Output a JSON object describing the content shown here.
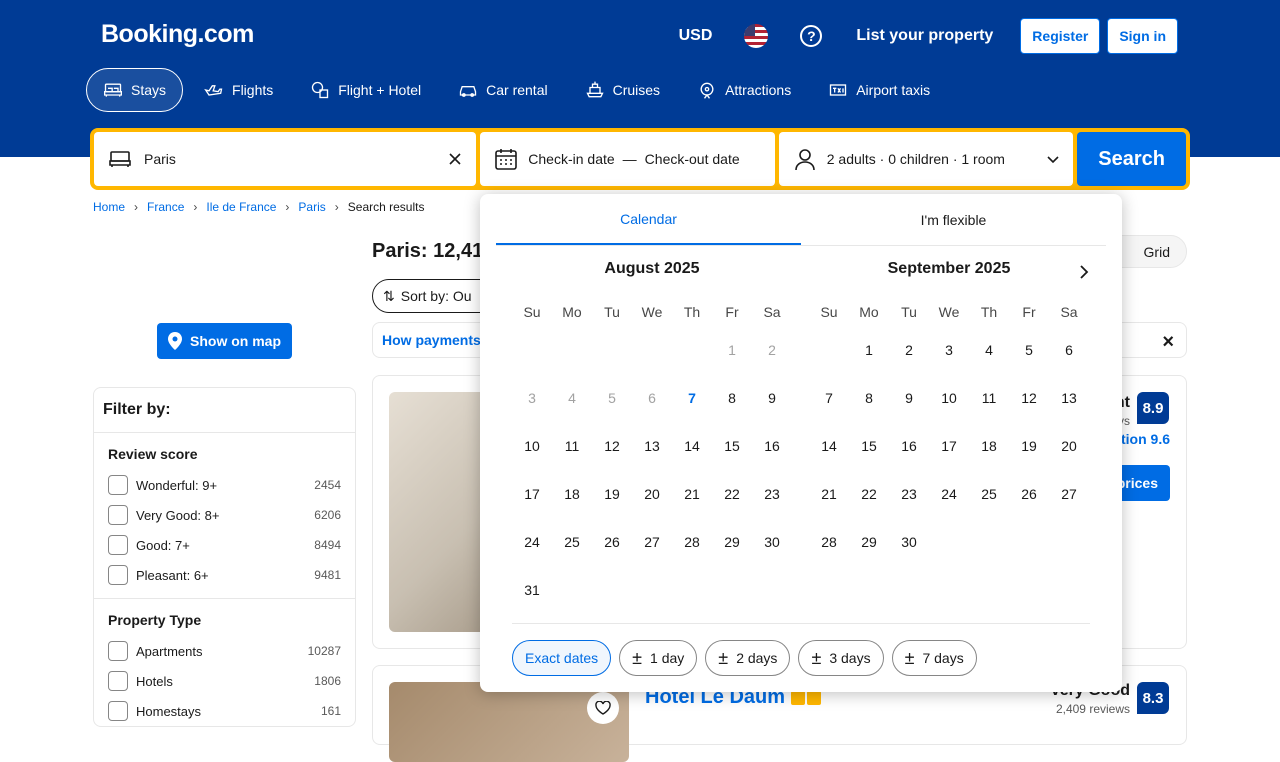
{
  "header": {
    "logo": "Booking.com",
    "currency": "USD",
    "help": "?",
    "list_property": "List your property",
    "register": "Register",
    "sign_in": "Sign in"
  },
  "nav_tabs": [
    {
      "label": "Stays",
      "icon": "bed-icon",
      "active": true
    },
    {
      "label": "Flights",
      "icon": "plane-icon"
    },
    {
      "label": "Flight + Hotel",
      "icon": "flight-hotel-icon"
    },
    {
      "label": "Car rental",
      "icon": "car-icon"
    },
    {
      "label": "Cruises",
      "icon": "ship-icon"
    },
    {
      "label": "Attractions",
      "icon": "attractions-icon"
    },
    {
      "label": "Airport taxis",
      "icon": "taxi-icon"
    }
  ],
  "search": {
    "destination": "Paris",
    "checkin": "Check-in date",
    "dash": "—",
    "checkout": "Check-out date",
    "occupancy": "2 adults · 0 children · 1 room",
    "button": "Search"
  },
  "breadcrumb": [
    "Home",
    "France",
    "Ile de France",
    "Paris",
    "Search results"
  ],
  "show_on_map": "Show on map",
  "results_title": "Paris: 12,41",
  "sort_label": "Sort by: Ou",
  "grid_label": "Grid",
  "payments_link": "How payments",
  "filter": {
    "title": "Filter by:",
    "review_title": "Review score",
    "review": [
      {
        "label": "Wonderful: 9+",
        "count": "2454"
      },
      {
        "label": "Very Good: 8+",
        "count": "6206"
      },
      {
        "label": "Good: 7+",
        "count": "8494"
      },
      {
        "label": "Pleasant: 6+",
        "count": "9481"
      }
    ],
    "type_title": "Property Type",
    "types": [
      {
        "label": "Apartments",
        "count": "10287"
      },
      {
        "label": "Hotels",
        "count": "1806"
      },
      {
        "label": "Homestays",
        "count": "161"
      }
    ]
  },
  "card1": {
    "review_label": "nt",
    "review_count": "vs",
    "score": "8.9",
    "location": "tion 9.6",
    "prices": "prices"
  },
  "card2": {
    "name": "Hotel Le Daum",
    "review_label": "Very Good",
    "review_count": "2,409 reviews",
    "score": "8.3"
  },
  "calendar": {
    "tab_calendar": "Calendar",
    "tab_flexible": "I'm flexible",
    "dow": [
      "Su",
      "Mo",
      "Tu",
      "We",
      "Th",
      "Fr",
      "Sa"
    ],
    "months": [
      {
        "title": "August 2025",
        "offset": 5,
        "days": 31,
        "past_until": 6,
        "today": 7
      },
      {
        "title": "September 2025",
        "offset": 1,
        "days": 30,
        "past_until": 0,
        "today": 0
      }
    ],
    "chips": [
      {
        "label": "Exact dates",
        "active": true
      },
      {
        "label": "1 day",
        "pm": true
      },
      {
        "label": "2 days",
        "pm": true
      },
      {
        "label": "3 days",
        "pm": true
      },
      {
        "label": "7 days",
        "pm": true
      }
    ]
  }
}
